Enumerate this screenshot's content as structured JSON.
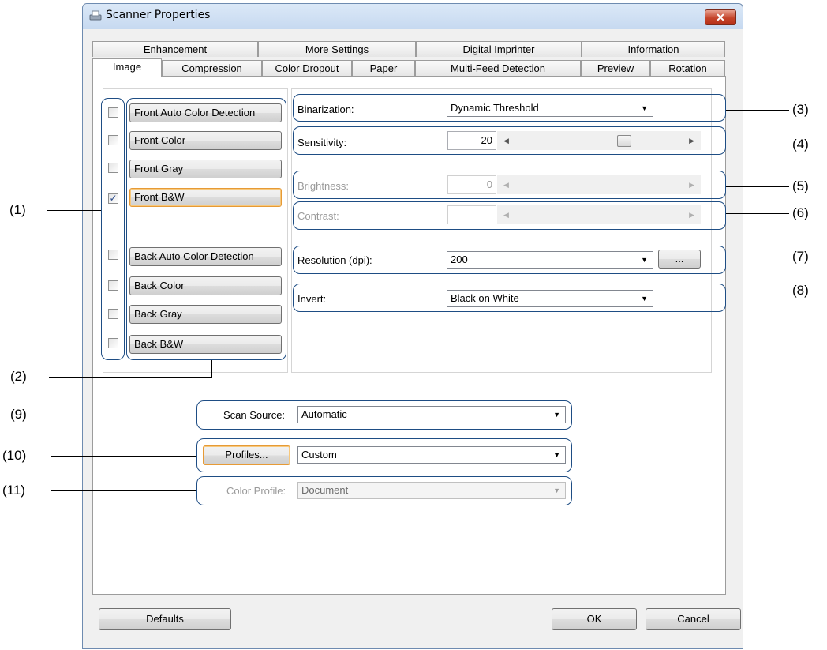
{
  "window": {
    "title": "Scanner Properties",
    "close_label": "✕"
  },
  "tabs_row1": [
    "Enhancement",
    "More Settings",
    "Digital Imprinter",
    "Information"
  ],
  "tabs_row2": [
    "Image",
    "Compression",
    "Color Dropout",
    "Paper",
    "Multi-Feed Detection",
    "Preview",
    "Rotation"
  ],
  "active_tab": "Image",
  "image_types": [
    {
      "label": "Front Auto Color Detection",
      "checked": false
    },
    {
      "label": "Front Color",
      "checked": false
    },
    {
      "label": "Front Gray",
      "checked": false
    },
    {
      "label": "Front B&W",
      "checked": true
    },
    {
      "label": "Back Auto Color Detection",
      "checked": false
    },
    {
      "label": "Back Color",
      "checked": false
    },
    {
      "label": "Back Gray",
      "checked": false
    },
    {
      "label": "Back B&W",
      "checked": false
    }
  ],
  "checkbox_glyph": "✓",
  "settings": {
    "binarization_label": "Binarization:",
    "binarization_value": "Dynamic Threshold",
    "sensitivity_label": "Sensitivity:",
    "sensitivity_value": "20",
    "brightness_label": "Brightness:",
    "brightness_value": "0",
    "contrast_label": "Contrast:",
    "contrast_value": "",
    "resolution_label": "Resolution (dpi):",
    "resolution_value": "200",
    "resolution_more": "...",
    "invert_label": "Invert:",
    "invert_value": "Black on White"
  },
  "bottom": {
    "scan_source_label": "Scan Source:",
    "scan_source_value": "Automatic",
    "profiles_button": "Profiles...",
    "profiles_value": "Custom",
    "color_profile_label": "Color Profile:",
    "color_profile_value": "Document"
  },
  "buttons": {
    "defaults": "Defaults",
    "ok": "OK",
    "cancel": "Cancel"
  },
  "arrows": {
    "down": "▼",
    "left": "◀",
    "right": "▶"
  },
  "callouts": [
    "(1)",
    "(2)",
    "(3)",
    "(4)",
    "(5)",
    "(6)",
    "(7)",
    "(8)",
    "(9)",
    "(10)",
    "(11)"
  ],
  "colors": {
    "callout_border": "#1e4d84",
    "focus_border": "#e69a36",
    "close_button": "#c4442a"
  }
}
